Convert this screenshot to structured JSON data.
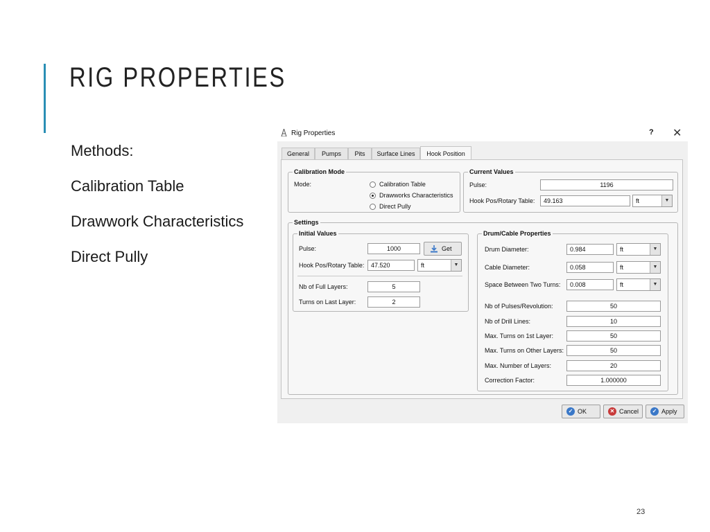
{
  "slide": {
    "title": "RIG PROPERTIES",
    "bullets": [
      "Methods:",
      "Calibration Table",
      "Drawwork Characteristics",
      "Direct Pully"
    ],
    "page_number": "23",
    "accent_color": "#2a8fb5"
  },
  "dialog": {
    "title": "Rig Properties",
    "help": "?",
    "close": "✕",
    "tabs": [
      "General",
      "Pumps",
      "Pits",
      "Surface Lines",
      "Hook Position"
    ],
    "active_tab": "Hook Position",
    "calibration_mode": {
      "legend": "Calibration Mode",
      "mode_label": "Mode:",
      "options": [
        "Calibration Table",
        "Drawworks Characteristics",
        "Direct Pully"
      ],
      "selected": "Drawworks Characteristics"
    },
    "current_values": {
      "legend": "Current Values",
      "pulse_label": "Pulse:",
      "pulse_value": "1196",
      "hook_label": "Hook Pos/Rotary Table:",
      "hook_value": "49.163",
      "hook_unit": "ft"
    },
    "settings": {
      "legend": "Settings",
      "initial_values": {
        "legend": "Initial Values",
        "pulse_label": "Pulse:",
        "pulse_value": "1000",
        "get_label": "Get",
        "hook_label": "Hook Pos/Rotary Table:",
        "hook_value": "47.520",
        "hook_unit": "ft",
        "full_layers_label": "Nb of Full Layers:",
        "full_layers_value": "5",
        "turns_last_label": "Turns on Last Layer:",
        "turns_last_value": "2"
      },
      "drum": {
        "legend": "Drum/Cable Properties",
        "drum_diameter_label": "Drum Diameter:",
        "drum_diameter_value": "0.984",
        "drum_diameter_unit": "ft",
        "cable_diameter_label": "Cable Diameter:",
        "cable_diameter_value": "0.058",
        "cable_diameter_unit": "ft",
        "space_label": "Space Between Two Turns:",
        "space_value": "0.008",
        "space_unit": "ft",
        "pulses_label": "Nb of Pulses/Revolution:",
        "pulses_value": "50",
        "drill_lines_label": "Nb of Drill Lines:",
        "drill_lines_value": "10",
        "max_turns_first_label": "Max. Turns on 1st Layer:",
        "max_turns_first_value": "50",
        "max_turns_other_label": "Max. Turns on Other Layers:",
        "max_turns_other_value": "50",
        "max_layers_label": "Max. Number of Layers:",
        "max_layers_value": "20",
        "correction_label": "Correction Factor:",
        "correction_value": "1.000000"
      }
    },
    "buttons": {
      "ok": "OK",
      "cancel": "Cancel",
      "apply": "Apply"
    },
    "colors": {
      "ok_icon": "#3a78c8",
      "cancel_icon": "#c83a3a",
      "apply_icon": "#3a78c8",
      "get_icon": "#3a78c8"
    }
  }
}
